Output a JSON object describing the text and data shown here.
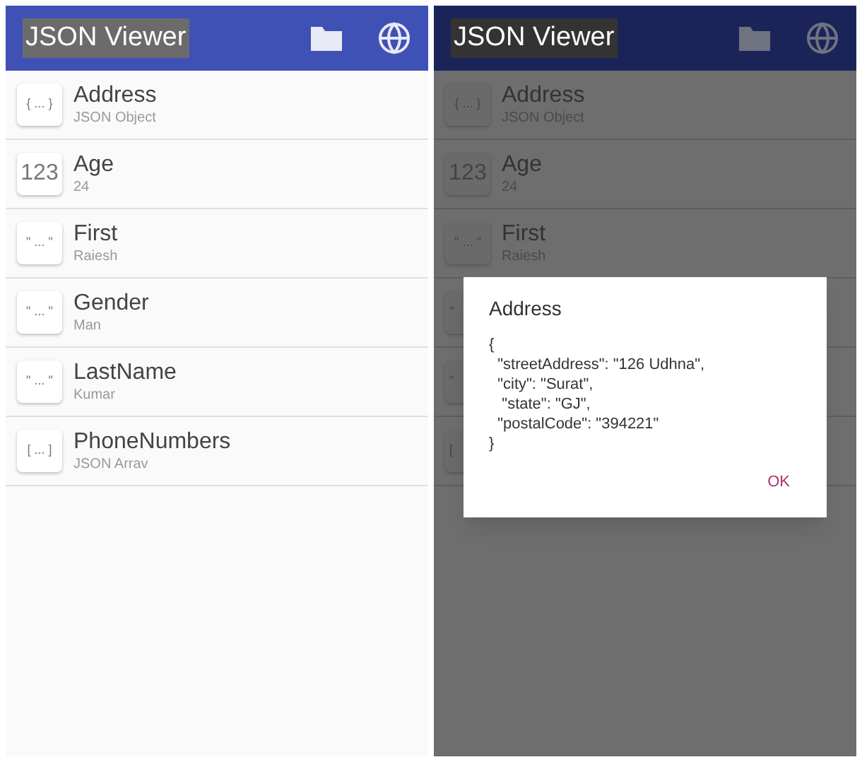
{
  "screens": [
    {
      "title": "JSON Viewer",
      "dimmed": false,
      "items": [
        {
          "icon_text": "{ ... }",
          "name": "Address",
          "value": "JSON Object"
        },
        {
          "icon_text": "123",
          "name": "Age",
          "value": "24"
        },
        {
          "icon_text": "\" ... \"",
          "name": "First",
          "value": "Raiesh"
        },
        {
          "icon_text": "\" ... \"",
          "name": "Gender",
          "value": "Man"
        },
        {
          "icon_text": "\" ... \"",
          "name": "LastName",
          "value": "Kumar"
        },
        {
          "icon_text": "[ ... ]",
          "name": "PhoneNumbers",
          "value": "JSON Arrav"
        }
      ]
    },
    {
      "title": "JSON Viewer",
      "dimmed": true,
      "items": [
        {
          "icon_text": "{ ... }",
          "name": "Address",
          "value": "JSON Object"
        },
        {
          "icon_text": "123",
          "name": "Age",
          "value": "24"
        },
        {
          "icon_text": "\" ... \"",
          "name": "First",
          "value": "Raiesh"
        },
        {
          "icon_text": "\""
        },
        {
          "icon_text": "\""
        },
        {
          "icon_text": "["
        }
      ],
      "dialog": {
        "title": "Address",
        "lines": [
          "{",
          "  \"streetAddress\": \"126 Udhna\",",
          "  \"city\": \"Surat\",",
          "   \"state\": \"GJ\",",
          "  \"postalCode\": \"394221\"",
          "}"
        ],
        "button": "OK"
      }
    }
  ]
}
